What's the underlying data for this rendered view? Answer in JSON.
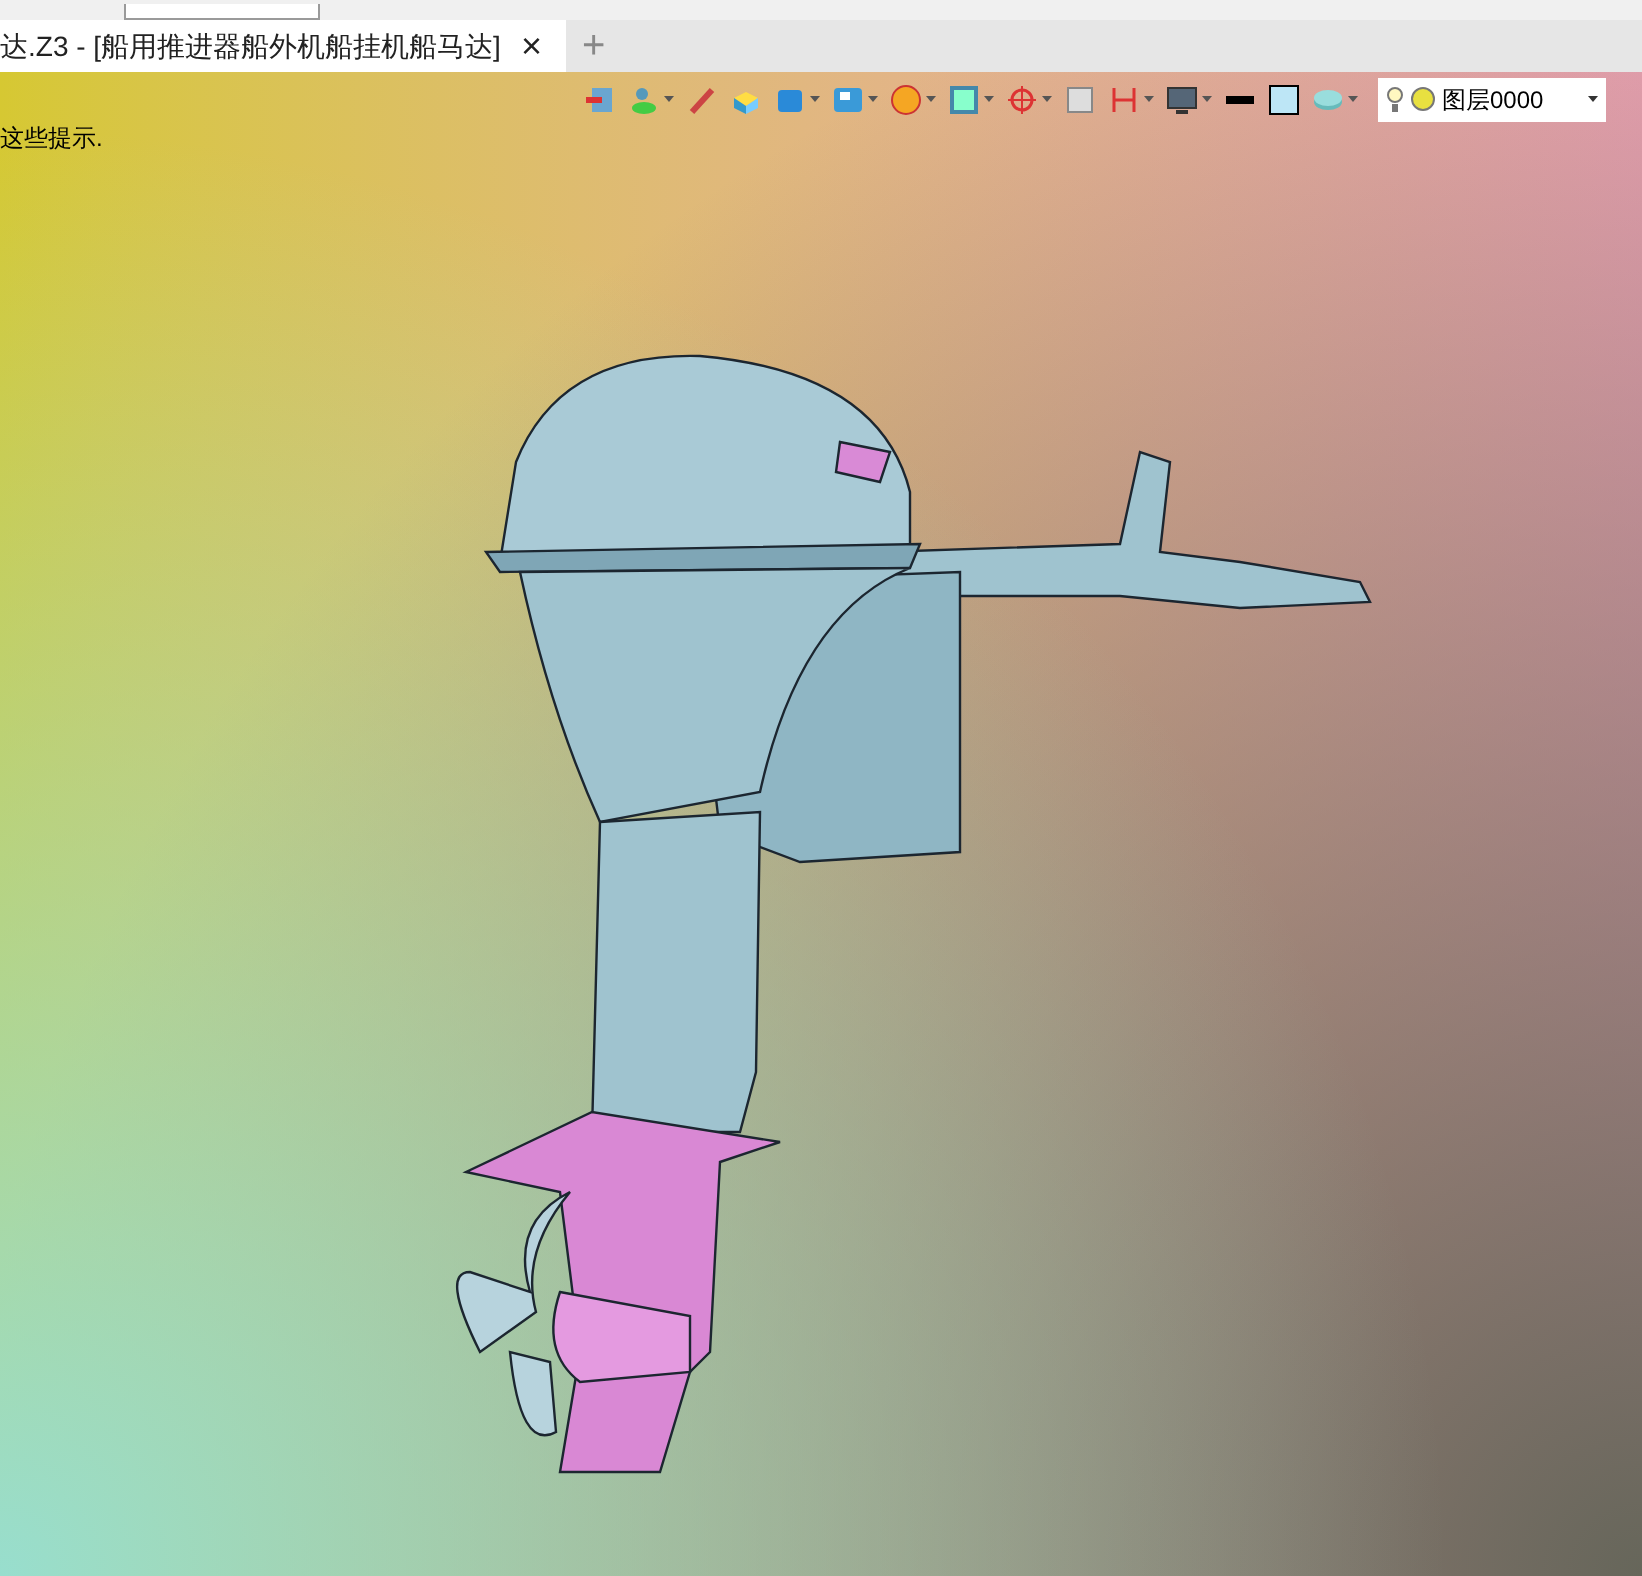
{
  "tabs": [
    {
      "label": "达.Z3 - [船用推进器船外机船挂机船马达]",
      "close": "×",
      "selected": true
    }
  ],
  "new_tab": "+",
  "viewport": {
    "hint": "这些提示.",
    "layer_dropdown": {
      "value": "图层0000"
    }
  }
}
